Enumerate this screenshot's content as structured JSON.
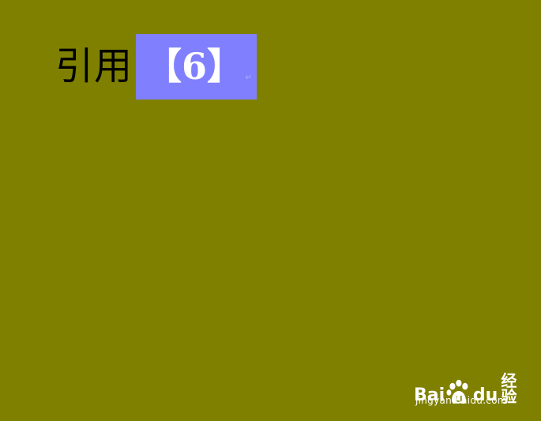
{
  "document": {
    "label": "引用",
    "citation": "【6】",
    "paragraph_mark": "↵"
  },
  "watermark": {
    "brand_left": "Bai",
    "brand_right": "du",
    "product": "经验",
    "url": "jingyan.baidu.com",
    "icon": "paw-icon"
  },
  "colors": {
    "background": "#808000",
    "selection": "#8080ff",
    "text": "#000000",
    "citation_text": "#ffffff"
  }
}
